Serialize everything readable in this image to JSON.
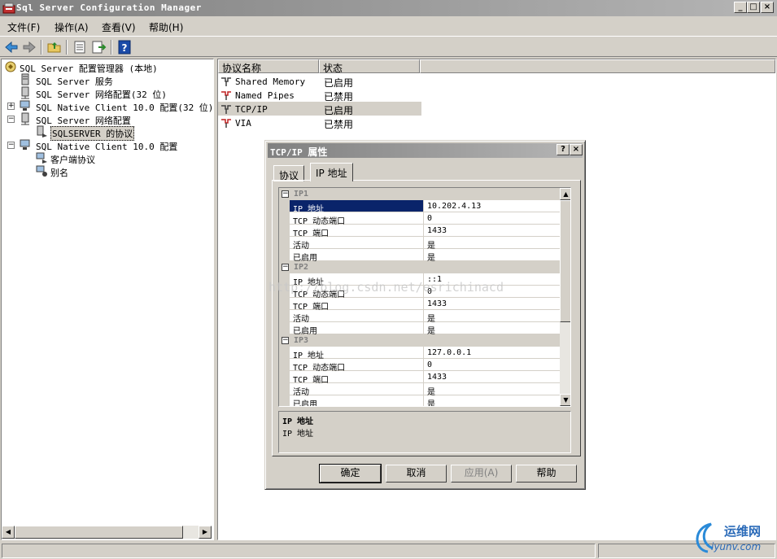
{
  "window": {
    "title": "Sql Server Configuration Manager",
    "min": "_",
    "max": "□",
    "close": "×"
  },
  "menu": [
    "文件(F)",
    "操作(A)",
    "查看(V)",
    "帮助(H)"
  ],
  "toolbar": [
    "back-icon",
    "forward-icon",
    "up-folder-icon",
    "properties-icon",
    "export-icon",
    "help-icon"
  ],
  "tree": [
    {
      "label": "SQL Server 配置管理器 (本地)",
      "level": 0
    },
    {
      "label": "SQL Server 服务",
      "level": 1
    },
    {
      "label": "SQL Server 网络配置(32 位)",
      "level": 1
    },
    {
      "label": "SQL Native Client 10.0 配置(32 位)",
      "level": 1,
      "expander": "+"
    },
    {
      "label": "SQL Server 网络配置",
      "level": 1,
      "expander": "−"
    },
    {
      "label": "SQLSERVER 的协议",
      "level": 2
    },
    {
      "label": "SQL Native Client 10.0 配置",
      "level": 1,
      "expander": "−"
    },
    {
      "label": "客户端协议",
      "level": 2
    },
    {
      "label": "别名",
      "level": 2
    }
  ],
  "list": {
    "columns": [
      "协议名称",
      "状态"
    ],
    "rows": [
      {
        "name": "Shared Memory",
        "status": "已启用"
      },
      {
        "name": "Named Pipes",
        "status": "已禁用"
      },
      {
        "name": "TCP/IP",
        "status": "已启用",
        "selected": true
      },
      {
        "name": "VIA",
        "status": "已禁用"
      }
    ]
  },
  "dialog": {
    "title_a": "TCP/IP",
    "title_b": "属性",
    "help": "?",
    "close": "×",
    "tabs": [
      "协议",
      "IP 地址"
    ],
    "groups": [
      {
        "name": "IP1",
        "rows": [
          [
            "IP 地址",
            "10.202.4.13"
          ],
          [
            "TCP 动态端口",
            "0"
          ],
          [
            "TCP 端口",
            "1433"
          ],
          [
            "活动",
            "是"
          ],
          [
            "已启用",
            "是"
          ]
        ]
      },
      {
        "name": "IP2",
        "rows": [
          [
            "IP 地址",
            "::1"
          ],
          [
            "TCP 动态端口",
            "0"
          ],
          [
            "TCP 端口",
            "1433"
          ],
          [
            "活动",
            "是"
          ],
          [
            "已启用",
            "是"
          ]
        ]
      },
      {
        "name": "IP3",
        "rows": [
          [
            "IP 地址",
            "127.0.0.1"
          ],
          [
            "TCP 动态端口",
            "0"
          ],
          [
            "TCP 端口",
            "1433"
          ],
          [
            "活动",
            "是"
          ],
          [
            "已启用",
            "是"
          ]
        ]
      }
    ],
    "desc_title": "IP 地址",
    "desc_body": "IP 地址",
    "buttons": {
      "ok": "确定",
      "cancel": "取消",
      "apply": "应用(A)",
      "help": "帮助"
    }
  },
  "watermark": "http://blog.csdn.net/esrichinacd",
  "logo": {
    "text": "运维网",
    "url": "iyunv.com"
  }
}
